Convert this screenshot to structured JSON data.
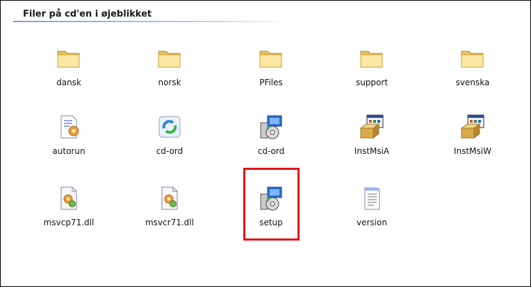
{
  "group": {
    "title": "Filer på cd'en i øjeblikket"
  },
  "highlight_color": "#e01212",
  "files": [
    {
      "label": "dansk",
      "icon": "folder-icon"
    },
    {
      "label": "norsk",
      "icon": "folder-icon"
    },
    {
      "label": "PFiles",
      "icon": "folder-icon"
    },
    {
      "label": "support",
      "icon": "folder-icon"
    },
    {
      "label": "svenska",
      "icon": "folder-icon"
    },
    {
      "label": "autorun",
      "icon": "setup-info-file-icon"
    },
    {
      "label": "cd-ord",
      "icon": "refresh-app-icon"
    },
    {
      "label": "cd-ord",
      "icon": "installer-icon"
    },
    {
      "label": "InstMsiA",
      "icon": "msi-installer-icon"
    },
    {
      "label": "InstMsiW",
      "icon": "msi-installer-icon"
    },
    {
      "label": "msvcp71.dll",
      "icon": "dll-file-icon"
    },
    {
      "label": "msvcr71.dll",
      "icon": "dll-file-icon"
    },
    {
      "label": "setup",
      "icon": "installer-icon"
    },
    {
      "label": "version",
      "icon": "text-file-icon"
    }
  ]
}
